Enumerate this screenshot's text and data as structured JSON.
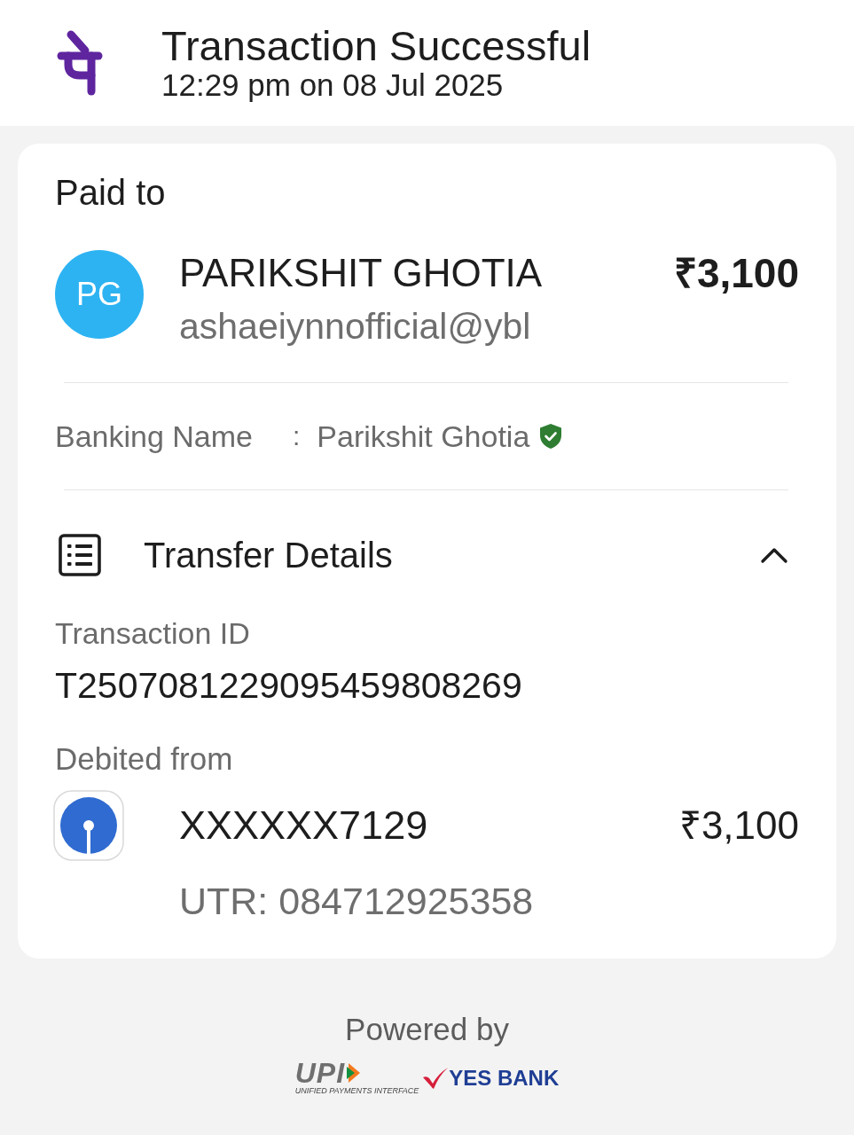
{
  "header": {
    "title": "Transaction Successful",
    "timestamp": "12:29 pm on 08 Jul 2025"
  },
  "paid_to": {
    "heading": "Paid to",
    "initials": "PG",
    "name": "PARIKSHIT GHOTIA",
    "upi_id": "ashaeiynnofficial@ybl",
    "amount": "₹3,100"
  },
  "banking_name": {
    "label": "Banking Name",
    "separator": ":",
    "value": "Parikshit Ghotia",
    "verified": true
  },
  "transfer_details": {
    "title": "Transfer Details",
    "expanded": true,
    "transaction_id": {
      "label": "Transaction ID",
      "value": "T2507081229095459808269"
    },
    "debited_from": {
      "label": "Debited from",
      "account": "XXXXXX7129",
      "amount": "₹3,100",
      "utr": "UTR: 084712925358"
    }
  },
  "footer": {
    "powered_by": "Powered by",
    "upi_logo": {
      "text": "UPI",
      "tagline": "UNIFIED PAYMENTS INTERFACE"
    },
    "bank_logo": {
      "text": "YES BANK"
    }
  }
}
